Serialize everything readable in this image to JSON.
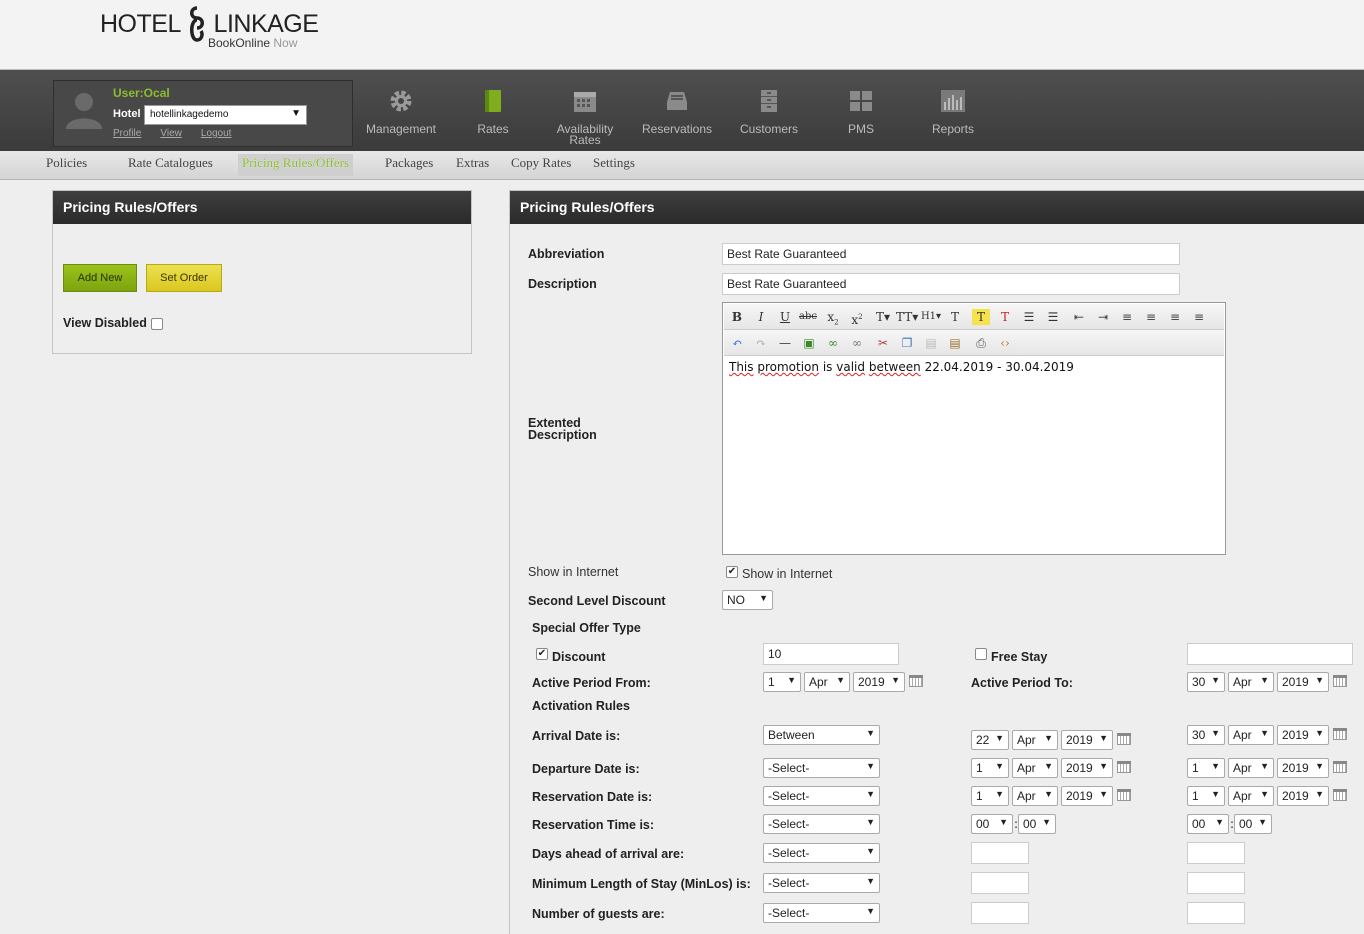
{
  "header": {
    "logo_text_left": "HOTEL",
    "logo_text_right": "LINKAGE",
    "tagline_main": "BookOnline",
    "tagline_accent": "Now"
  },
  "user": {
    "name": "User:Ocal",
    "hotel_label": "Hotel",
    "hotel_value": "hotellinkagedemo",
    "links": [
      "Profile",
      "View",
      "Logout"
    ]
  },
  "nav": [
    {
      "label": "Management",
      "icon": "gear-icon"
    },
    {
      "label": "Rates",
      "icon": "book-icon"
    },
    {
      "label": "Availability Rates",
      "icon": "calendar-icon"
    },
    {
      "label": "Reservations",
      "icon": "inbox-icon"
    },
    {
      "label": "Customers",
      "icon": "cabinet-icon"
    },
    {
      "label": "PMS",
      "icon": "grid-icon"
    },
    {
      "label": "Reports",
      "icon": "bar-chart-icon"
    }
  ],
  "subnav": [
    "Policies",
    "Rate Catalogues",
    "Pricing Rules/Offers",
    "Packages",
    "Extras",
    "Copy Rates",
    "Settings"
  ],
  "subnav_active": "Pricing Rules/Offers",
  "left_panel": {
    "title": "Pricing Rules/Offers",
    "add_new": "Add New",
    "set_order": "Set Order",
    "view_disabled": "View Disabled"
  },
  "form": {
    "title": "Pricing Rules/Offers",
    "abbreviation_label": "Abbreviation",
    "abbreviation_value": "Best Rate Guaranteed",
    "description_label": "Description",
    "description_value": "Best Rate Guaranteed",
    "extended_label_1": "Extented",
    "extended_label_2": "Description",
    "editor_words": [
      "This",
      "promotion",
      "is",
      "valid",
      "between",
      "22.04.2019 - 30.04.2019"
    ],
    "show_internet_label": "Show in Internet",
    "show_internet_check": "Show in Internet",
    "second_level_label": "Second Level Discount",
    "second_level_value": "NO",
    "special_offer_label": "Special Offer Type",
    "discount_label": "Discount",
    "discount_value": "10",
    "free_stay_label": "Free Stay",
    "active_from_label": "Active Period From:",
    "active_from": {
      "day": "1",
      "month": "Apr",
      "year": "2019"
    },
    "active_to_label": "Active Period To:",
    "active_to": {
      "day": "30",
      "month": "Apr",
      "year": "2019"
    },
    "activation_rules_label": "Activation Rules",
    "rules": [
      {
        "label": "Arrival Date is:",
        "value": "Between",
        "from": {
          "day": "22",
          "month": "Apr",
          "year": "2019"
        },
        "to": {
          "day": "30",
          "month": "Apr",
          "year": "2019"
        }
      },
      {
        "label": "Departure Date is:",
        "value": "-Select-",
        "from": {
          "day": "1",
          "month": "Apr",
          "year": "2019"
        },
        "to": {
          "day": "1",
          "month": "Apr",
          "year": "2019"
        }
      },
      {
        "label": "Reservation Date is:",
        "value": "-Select-",
        "from": {
          "day": "1",
          "month": "Apr",
          "year": "2019"
        },
        "to": {
          "day": "1",
          "month": "Apr",
          "year": "2019"
        }
      },
      {
        "label": "Reservation Time is:",
        "value": "-Select-",
        "from_h": "00",
        "from_m": "00",
        "to_h": "00",
        "to_m": "00"
      },
      {
        "label": "Days ahead of arrival are:",
        "value": "-Select-"
      },
      {
        "label": "Minimum Length of Stay (MinLos) is:",
        "value": "-Select-"
      },
      {
        "label": "Number of guests are:",
        "value": "-Select-"
      }
    ]
  },
  "colors": {
    "accent_green": "#8cbd2e",
    "header_dark": "#3b3b3b"
  }
}
